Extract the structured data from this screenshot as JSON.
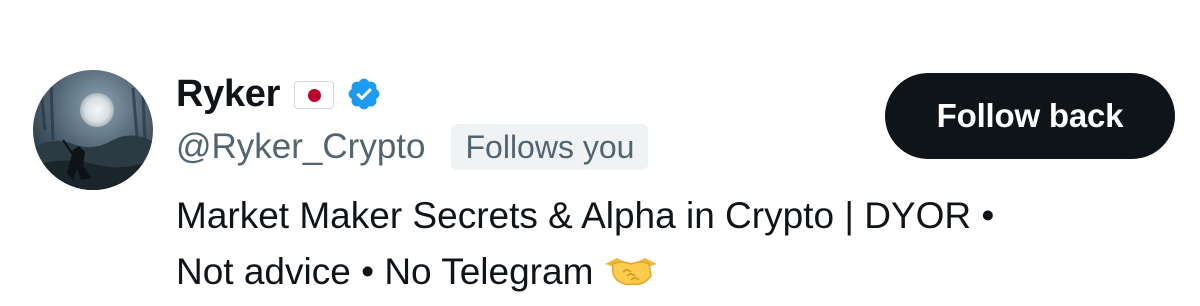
{
  "profile": {
    "display_name": "Ryker",
    "flag_icon": "japan-flag-icon",
    "verified_icon": "verified-badge-icon",
    "handle": "@Ryker_Crypto",
    "follows_badge": "Follows you",
    "bio_line1": "Market Maker Secrets & Alpha in Crypto | DYOR •",
    "bio_line2": "Not advice • No Telegram",
    "bio_emoji": "handshake-icon"
  },
  "actions": {
    "follow_label": "Follow back"
  },
  "colors": {
    "text_primary": "#0f1419",
    "text_secondary": "#536471",
    "badge_bg": "#eff3f4",
    "button_bg": "#0f1419",
    "button_text": "#ffffff",
    "verified_blue": "#1d9bf0",
    "flag_red": "#bc002d"
  }
}
